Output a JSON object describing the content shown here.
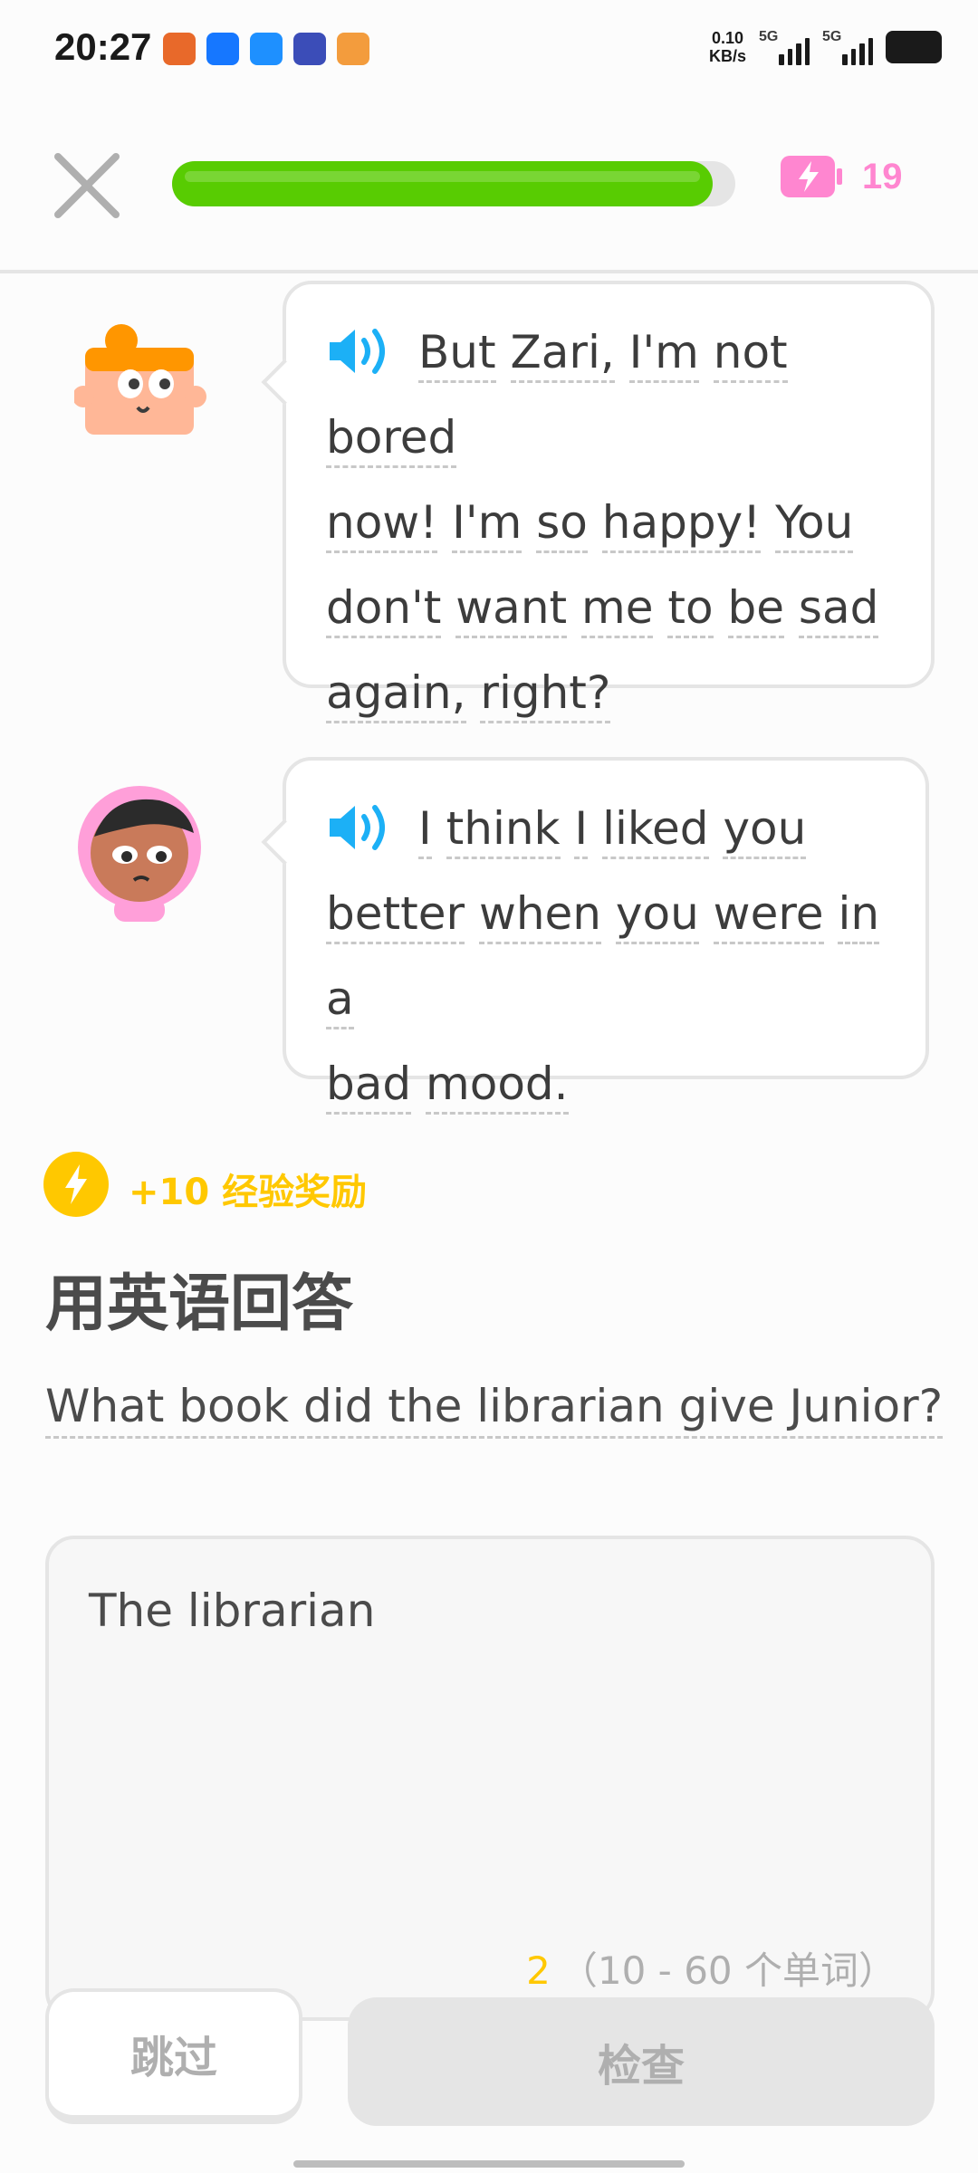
{
  "status_bar": {
    "time": "20:27",
    "net_speed_value": "0.10",
    "net_speed_unit": "KB/s",
    "sim1_label": "5G",
    "sim2_label": "5G"
  },
  "header": {
    "progress": 0.96,
    "energy_count": "19"
  },
  "chat": [
    {
      "speaker": "Junior",
      "lines": [
        [
          "But",
          "Zari,",
          "I'm",
          "not",
          "bored"
        ],
        [
          "now!",
          "I'm",
          "so",
          "happy!",
          "You"
        ],
        [
          "don't",
          "want",
          "me",
          "to",
          "be",
          "sad"
        ],
        [
          "again,",
          "right?"
        ]
      ]
    },
    {
      "speaker": "Zari",
      "lines": [
        [
          "I",
          "think",
          "I",
          "liked",
          "you"
        ],
        [
          "better",
          "when",
          "you",
          "were",
          "in",
          "a"
        ],
        [
          "bad",
          "mood."
        ]
      ]
    }
  ],
  "xp_bonus": "+10 经验奖励",
  "prompt_title": "用英语回答",
  "question": "What book did the librarian give Junior?",
  "answer": {
    "value": "The librarian",
    "word_count": "2",
    "word_range": "（10 - 60 个单词）"
  },
  "buttons": {
    "skip": "跳过",
    "check": "检查"
  },
  "colors": {
    "progress_green": "#58cc02",
    "energy_pink": "#ff86d0",
    "xp_gold": "#ffc800",
    "speaker_blue": "#1cb0f6"
  }
}
